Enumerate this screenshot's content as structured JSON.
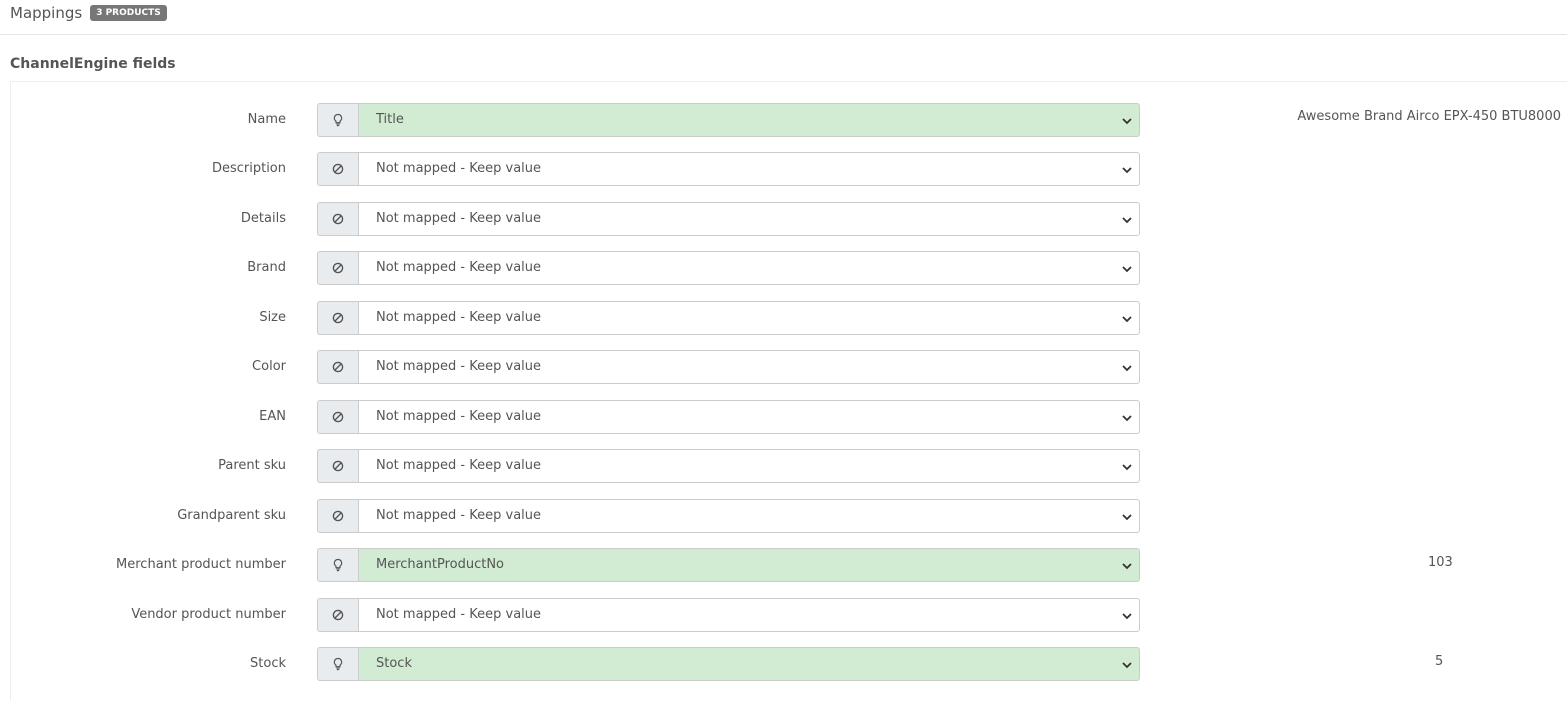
{
  "header": {
    "title": "Mappings",
    "badge": "3 PRODUCTS"
  },
  "section": {
    "title": "ChannelEngine fields"
  },
  "fields": [
    {
      "label": "Name",
      "value": "Title",
      "mapped": true,
      "icon": "lightbulb-icon",
      "preview": "Awesome Brand Airco EPX-450 BTU8000"
    },
    {
      "label": "Description",
      "value": "Not mapped - Keep value",
      "mapped": false,
      "icon": "ban-icon",
      "preview": ""
    },
    {
      "label": "Details",
      "value": "Not mapped - Keep value",
      "mapped": false,
      "icon": "ban-icon",
      "preview": ""
    },
    {
      "label": "Brand",
      "value": "Not mapped - Keep value",
      "mapped": false,
      "icon": "ban-icon",
      "preview": ""
    },
    {
      "label": "Size",
      "value": "Not mapped - Keep value",
      "mapped": false,
      "icon": "ban-icon",
      "preview": ""
    },
    {
      "label": "Color",
      "value": "Not mapped - Keep value",
      "mapped": false,
      "icon": "ban-icon",
      "preview": ""
    },
    {
      "label": "EAN",
      "value": "Not mapped - Keep value",
      "mapped": false,
      "icon": "ban-icon",
      "preview": ""
    },
    {
      "label": "Parent sku",
      "value": "Not mapped - Keep value",
      "mapped": false,
      "icon": "ban-icon",
      "preview": ""
    },
    {
      "label": "Grandparent sku",
      "value": "Not mapped - Keep value",
      "mapped": false,
      "icon": "ban-icon",
      "preview": ""
    },
    {
      "label": "Merchant product number",
      "value": "MerchantProductNo",
      "mapped": true,
      "icon": "lightbulb-icon",
      "preview": "103"
    },
    {
      "label": "Vendor product number",
      "value": "Not mapped - Keep value",
      "mapped": false,
      "icon": "ban-icon",
      "preview": ""
    },
    {
      "label": "Stock",
      "value": "Stock",
      "mapped": true,
      "icon": "lightbulb-icon",
      "preview": "5"
    }
  ],
  "colors": {
    "mapped_bg": "#d2ecd4",
    "addon_bg": "#e9ecef",
    "badge_bg": "#777777"
  }
}
